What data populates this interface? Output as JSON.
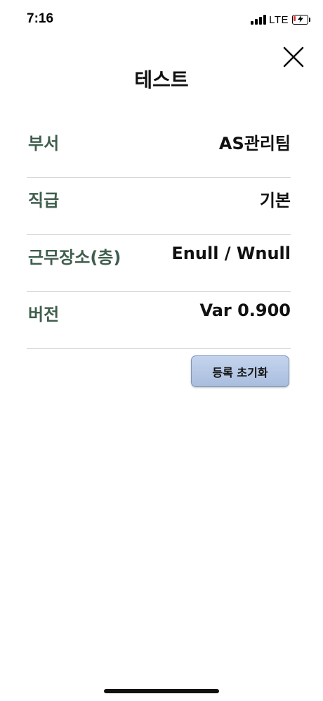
{
  "status_bar": {
    "time": "7:16",
    "network": "LTE",
    "battery_color": "#e53935"
  },
  "header": {
    "title": "테스트",
    "close_icon": "close-icon"
  },
  "info_rows": [
    {
      "label": "부서",
      "value": "AS관리팀"
    },
    {
      "label": "직급",
      "value": "기본"
    },
    {
      "label": "근무장소(층)",
      "value": "Enull / Wnull"
    },
    {
      "label": "버전",
      "value": "Var 0.900"
    }
  ],
  "actions": {
    "reset_label": "등록 초기화"
  },
  "colors": {
    "label": "#3f5e4d",
    "button_fill": "#b6c8e6"
  }
}
